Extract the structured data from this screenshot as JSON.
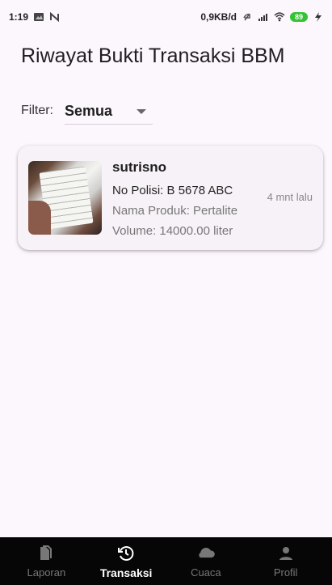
{
  "status_bar": {
    "time": "1:19",
    "network": "0,9KB/d",
    "battery": "89"
  },
  "page": {
    "title": "Riwayat Bukti Transaksi BBM"
  },
  "filter": {
    "label": "Filter:",
    "selected": "Semua"
  },
  "transactions": [
    {
      "name": "sutrisno",
      "plate": "No Polisi: B 5678 ABC",
      "product": "Nama Produk: Pertalite",
      "volume": "Volume: 14000.00 liter",
      "time_ago": "4 mnt lalu"
    }
  ],
  "bottom_nav": {
    "items": [
      {
        "label": "Laporan",
        "icon": "document-icon",
        "active": false
      },
      {
        "label": "Transaksi",
        "icon": "history-icon",
        "active": true
      },
      {
        "label": "Cuaca",
        "icon": "cloud-icon",
        "active": false
      },
      {
        "label": "Profil",
        "icon": "person-icon",
        "active": false
      }
    ]
  },
  "colors": {
    "background": "#fcf6fd",
    "card": "#f7f2f7",
    "nav_background": "#070607",
    "active_nav": "#ffffff",
    "inactive_nav": "#777777"
  }
}
